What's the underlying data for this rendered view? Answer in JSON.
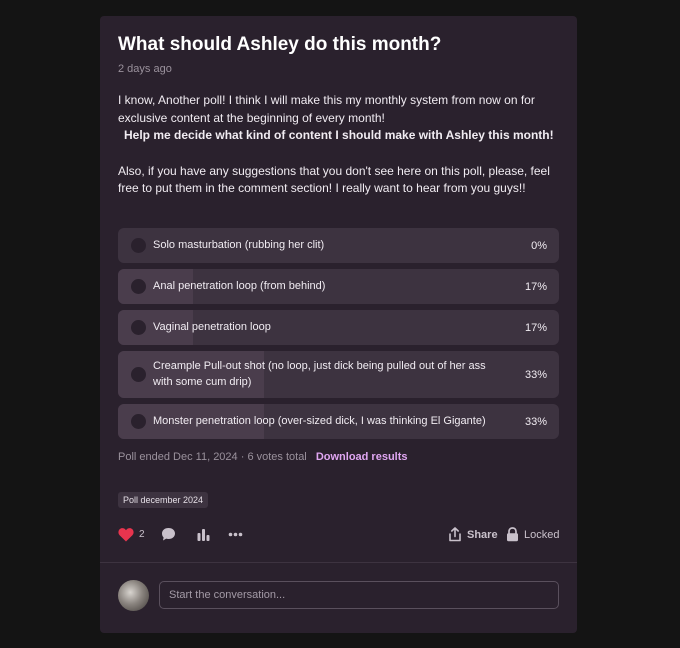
{
  "post": {
    "title": "What should Ashley do this month?",
    "date": "2 days ago",
    "body_line1": " I know, Another poll! I think I will make this my monthly system from now on for exclusive content at the beginning of every month!",
    "body_bold": "Help me decide what kind of content I should make with Ashley this month!",
    "body_line2": "Also, if you have any suggestions that you don't see here on this poll, please, feel free to put them in the comment section! I really want to hear from you guys!!"
  },
  "poll": {
    "options": [
      {
        "label": "Solo masturbation (rubbing her clit)",
        "percent_text": "0%",
        "percent": 0
      },
      {
        "label": "Anal penetration loop (from behind)",
        "percent_text": "17%",
        "percent": 17
      },
      {
        "label": "Vaginal penetration loop",
        "percent_text": "17%",
        "percent": 17
      },
      {
        "label": "Creample Pull-out shot (no loop, just dick being pulled out of her ass with some cum drip)",
        "percent_text": "33%",
        "percent": 33
      },
      {
        "label": "Monster penetration loop (over-sized dick, I was thinking El Gigante)",
        "percent_text": "33%",
        "percent": 33
      }
    ],
    "footer_text": "Poll ended Dec 11, 2024 · 6 votes total",
    "download_label": "Download results"
  },
  "tag": "Poll december 2024",
  "actions": {
    "like_count": "2",
    "share_label": "Share",
    "locked_label": "Locked"
  },
  "comment": {
    "placeholder": "Start the conversation..."
  },
  "colors": {
    "accent": "#e0a6f2",
    "heart": "#e8344e",
    "card": "#2a212d",
    "page": "#141414"
  }
}
